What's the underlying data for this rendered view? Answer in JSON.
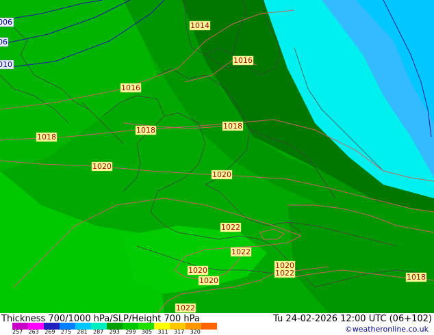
{
  "map": {
    "isobars": [
      {
        "value": "1014",
        "color": "#c00000"
      },
      {
        "value": "1016",
        "color": "#c00000"
      },
      {
        "value": "1018",
        "color": "#c00000"
      },
      {
        "value": "1020",
        "color": "#c00000"
      },
      {
        "value": "1022",
        "color": "#c00000"
      }
    ],
    "height_labels": [
      "006",
      "06",
      "010"
    ],
    "colors": {
      "green_1": "#00c800",
      "green_2": "#00b400",
      "green_3": "#00a000",
      "green_4": "#008c00",
      "green_5": "#007800",
      "cyan_light": "#00f0f0",
      "cyan": "#00c8ff",
      "blue_light": "#33bbff",
      "isobar": "#c86464",
      "height_line": "#0000c8",
      "border": "#404040"
    }
  },
  "footer": {
    "title": "Thickness 700/1000 hPa/SLP/Height 700 hPa",
    "datetime": "Tu 24-02-2026 12:00 UTC (06+102)",
    "credit": "©weatheronline.co.uk",
    "colorbar": {
      "colors": [
        "#c800c8",
        "#ff00ff",
        "#2020c0",
        "#0080ff",
        "#00c8ff",
        "#00f0c0",
        "#00a000",
        "#00c800",
        "#20e000",
        "#ffff00",
        "#ffc800",
        "#ff9600",
        "#ff6400"
      ],
      "ticks": [
        "257",
        "263",
        "269",
        "275",
        "281",
        "287",
        "293",
        "299",
        "305",
        "311",
        "317",
        "320"
      ]
    }
  }
}
